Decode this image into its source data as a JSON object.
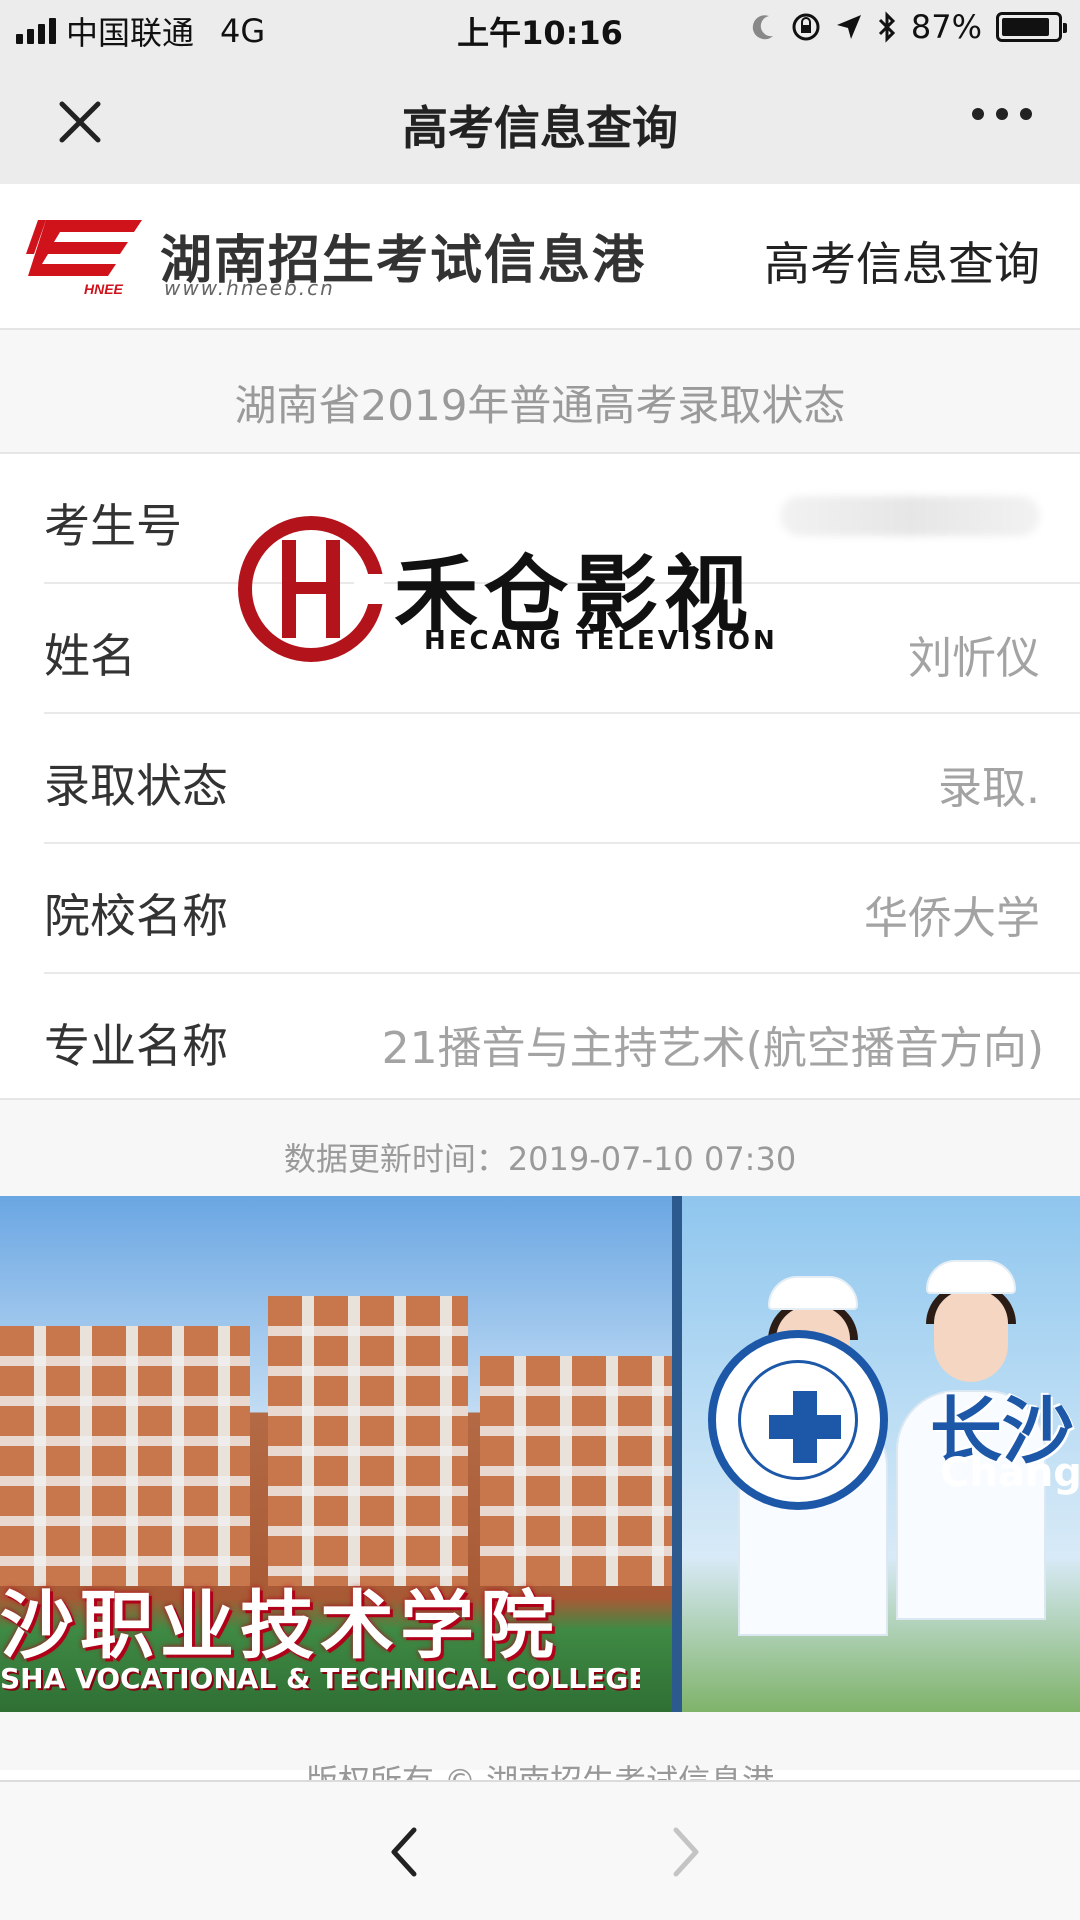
{
  "status_bar": {
    "carrier": "中国联通",
    "network": "4G",
    "time": "上午10:16",
    "battery": "87%",
    "battery_level": 0.87
  },
  "nav": {
    "title": "高考信息查询",
    "close_icon": "close-icon",
    "more_icon": "more-icon"
  },
  "header": {
    "site_name": "湖南招生考试信息港",
    "site_url": "www.hneeb.cn",
    "logo_text": "HNEE",
    "link": "高考信息查询"
  },
  "section_title": "湖南省2019年普通高考录取状态",
  "fields": [
    {
      "label": "考生号",
      "value": ""
    },
    {
      "label": "姓名",
      "value": "刘忻仪"
    },
    {
      "label": "录取状态",
      "value": "录取."
    },
    {
      "label": "院校名称",
      "value": "华侨大学"
    },
    {
      "label": "专业名称",
      "value": "21播音与主持艺术(航空播音方向)"
    }
  ],
  "update_time": "数据更新时间：2019-07-10 07:30",
  "carousel": {
    "slide_a_title": "沙职业技术学院",
    "slide_a_subtitle": "SHA VOCATIONAL & TECHNICAL COLLEGE",
    "slide_b_title": "长沙",
    "slide_b_latin": "Chang"
  },
  "copyright": "版权所有 © 湖南招生考试信息港",
  "watermark": {
    "title": "禾仓影视",
    "subtitle": "HECANG TELEVISION"
  },
  "toolbar": {
    "back_icon": "chevron-left-icon",
    "forward_icon": "chevron-right-icon"
  },
  "colors": {
    "accent_red": "#c8102e",
    "nav_bg": "#ececec",
    "value_gray": "#a3a3a3"
  }
}
